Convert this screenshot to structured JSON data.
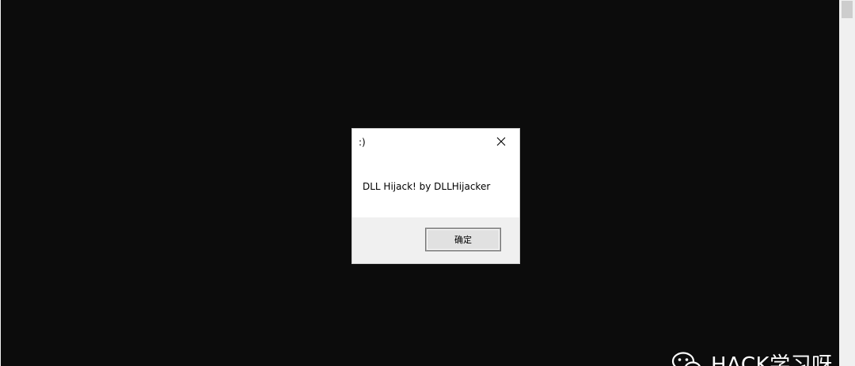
{
  "dialog": {
    "title": ":)",
    "message": "DLL Hijack! by DLLHijacker",
    "ok_label": "确定",
    "close_icon": "close-icon"
  },
  "watermark": {
    "text": "HACK学习呀",
    "icon": "wechat-icon"
  },
  "colors": {
    "console_background": "#0c0c0c",
    "dialog_background": "#ffffff",
    "dialog_footer": "#f0f0f0",
    "button_face": "#e1e1e1"
  }
}
